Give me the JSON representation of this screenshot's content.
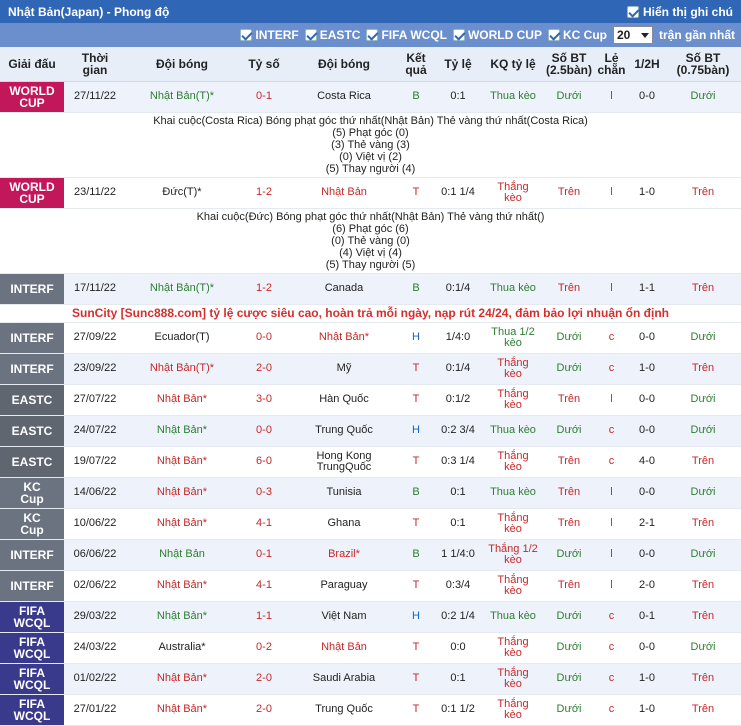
{
  "header": {
    "title": "Nhật Bản(Japan) - Phong độ",
    "show_note_label": "Hiển thị ghi chú"
  },
  "filters": {
    "items": [
      "INTERF",
      "EASTC",
      "FIFA WCQL",
      "WORLD CUP",
      "KC Cup"
    ],
    "count_value": "20",
    "count_suffix": "trận gần nhất"
  },
  "columns": [
    "Giải đấu",
    "Thời gian",
    "Đội bóng",
    "Tỷ số",
    "Đội bóng",
    "Kết quả",
    "Tỷ lệ",
    "KQ tỷ lệ",
    "Số BT (2.5bàn)",
    "Lẻ chẵn",
    "1/2H",
    "Số BT (0.75bàn)"
  ],
  "columns_split": [
    [
      "Giải đấu"
    ],
    [
      "Thời",
      "gian"
    ],
    [
      "Đội bóng"
    ],
    [
      "Tỷ số"
    ],
    [
      "Đội bóng"
    ],
    [
      "Kết",
      "quả"
    ],
    [
      "Tỷ lệ"
    ],
    [
      "KQ tỷ lệ"
    ],
    [
      "Số BT",
      "(2.5bàn)"
    ],
    [
      "Lẻ",
      "chẵn"
    ],
    [
      "1/2H"
    ],
    [
      "Số BT",
      "(0.75bàn)"
    ]
  ],
  "ad_text": "SunCity [Sunc888.com] tỷ lệ cược siêu cao, hoàn trả mỗi ngày, nạp rút 24/24, đảm bảo lợi nhuận ổn định",
  "rows": [
    {
      "league": "WORLD CUP",
      "lg": "WORLD",
      "date": "27/11/22",
      "home": "Nhật Bản(T)*",
      "home_style": "jp",
      "score": "0-1",
      "away": "Costa Rica",
      "away_style": "",
      "res": "B",
      "hc": "0:1",
      "kq": "Thua kèo",
      "kq_style": "lose",
      "ou": "Dưới",
      "le": "l",
      "half": "0-0",
      "ou2": "Dưới",
      "detail": [
        "Khai cuộc(Costa Rica)  Bóng phạt góc thứ nhất(Nhật Bản)  Thẻ vàng thứ nhất(Costa Rica)",
        "(5) Phạt góc (0)",
        "(3) Thẻ vàng (3)",
        "(0) Việt vị (2)",
        "(5) Thay người (4)"
      ]
    },
    {
      "league": "WORLD CUP",
      "lg": "WORLD",
      "date": "23/11/22",
      "home": "Đức(T)*",
      "home_style": "",
      "score": "1-2",
      "away": "Nhật Bản",
      "away_style": "hl",
      "res": "T",
      "hc": "0:1 1/4",
      "kq": "Thắng kèo",
      "kq_style": "win",
      "ou": "Trên",
      "le": "l",
      "half": "1-0",
      "ou2": "Trên",
      "detail": [
        "Khai cuộc(Đức)  Bóng phạt góc thứ nhất(Nhật Bản)  Thẻ vàng thứ nhất()",
        "(6) Phạt góc (6)",
        "(0) Thẻ vàng (0)",
        "(4) Việt vị (4)",
        "(5) Thay người (5)"
      ]
    },
    {
      "league": "INTERF",
      "lg": "INTERF",
      "date": "17/11/22",
      "home": "Nhật Bản(T)*",
      "home_style": "jp",
      "score": "1-2",
      "away": "Canada",
      "away_style": "",
      "res": "B",
      "hc": "0:1/4",
      "kq": "Thua kèo",
      "kq_style": "lose",
      "ou": "Trên",
      "le": "l",
      "half": "1-1",
      "ou2": "Trên"
    },
    {
      "ad": true
    },
    {
      "league": "INTERF",
      "lg": "INTERF",
      "date": "27/09/22",
      "home": "Ecuador(T)",
      "home_style": "",
      "score": "0-0",
      "away": "Nhật Bản*",
      "away_style": "hl",
      "res": "H",
      "hc": "1/4:0",
      "kq": "Thua 1/2 kèo",
      "kq_style": "lose",
      "ou": "Dưới",
      "le": "c",
      "half": "0-0",
      "ou2": "Dưới"
    },
    {
      "league": "INTERF",
      "lg": "INTERF",
      "date": "23/09/22",
      "home": "Nhật Bản(T)*",
      "home_style": "hl",
      "score": "2-0",
      "away": "Mỹ",
      "away_style": "",
      "res": "T",
      "hc": "0:1/4",
      "kq": "Thắng kèo",
      "kq_style": "win",
      "ou": "Dưới",
      "le": "c",
      "half": "1-0",
      "ou2": "Trên"
    },
    {
      "league": "EASTC",
      "lg": "EASTC",
      "date": "27/07/22",
      "home": "Nhật Bản*",
      "home_style": "hl",
      "score": "3-0",
      "away": "Hàn Quốc",
      "away_style": "",
      "res": "T",
      "hc": "0:1/2",
      "kq": "Thắng kèo",
      "kq_style": "win",
      "ou": "Trên",
      "le": "l",
      "half": "0-0",
      "ou2": "Dưới"
    },
    {
      "league": "EASTC",
      "lg": "EASTC",
      "date": "24/07/22",
      "home": "Nhật Bản*",
      "home_style": "jp",
      "score": "0-0",
      "away": "Trung Quốc",
      "away_style": "",
      "res": "H",
      "hc": "0:2 3/4",
      "kq": "Thua kèo",
      "kq_style": "lose",
      "ou": "Dưới",
      "le": "c",
      "half": "0-0",
      "ou2": "Dưới"
    },
    {
      "league": "EASTC",
      "lg": "EASTC",
      "date": "19/07/22",
      "home": "Nhật Bản*",
      "home_style": "hl",
      "score": "6-0",
      "away": "Hong Kong TrungQuốc",
      "away_style": "",
      "res": "T",
      "hc": "0:3 1/4",
      "kq": "Thắng kèo",
      "kq_style": "win",
      "ou": "Trên",
      "le": "c",
      "half": "4-0",
      "ou2": "Trên"
    },
    {
      "league": "KC Cup",
      "lg": "KC",
      "date": "14/06/22",
      "home": "Nhật Bản*",
      "home_style": "hl",
      "score": "0-3",
      "away": "Tunisia",
      "away_style": "",
      "res": "B",
      "hc": "0:1",
      "kq": "Thua kèo",
      "kq_style": "lose",
      "ou": "Trên",
      "le": "l",
      "half": "0-0",
      "ou2": "Dưới"
    },
    {
      "league": "KC Cup",
      "lg": "KC",
      "date": "10/06/22",
      "home": "Nhật Bản*",
      "home_style": "hl",
      "score": "4-1",
      "away": "Ghana",
      "away_style": "",
      "res": "T",
      "hc": "0:1",
      "kq": "Thắng kèo",
      "kq_style": "win",
      "ou": "Trên",
      "le": "l",
      "half": "2-1",
      "ou2": "Trên"
    },
    {
      "league": "INTERF",
      "lg": "INTERF",
      "date": "06/06/22",
      "home": "Nhật Bản",
      "home_style": "jp",
      "score": "0-1",
      "away": "Brazil*",
      "away_style": "hl",
      "res": "B",
      "hc": "1 1/4:0",
      "kq": "Thắng 1/2 kèo",
      "kq_style": "win",
      "ou": "Dưới",
      "le": "l",
      "half": "0-0",
      "ou2": "Dưới"
    },
    {
      "league": "INTERF",
      "lg": "INTERF",
      "date": "02/06/22",
      "home": "Nhật Bản*",
      "home_style": "hl",
      "score": "4-1",
      "away": "Paraguay",
      "away_style": "",
      "res": "T",
      "hc": "0:3/4",
      "kq": "Thắng kèo",
      "kq_style": "win",
      "ou": "Trên",
      "le": "l",
      "half": "2-0",
      "ou2": "Trên"
    },
    {
      "league": "FIFA WCQL",
      "lg": "FIFA",
      "date": "29/03/22",
      "home": "Nhật Bản*",
      "home_style": "jp",
      "score": "1-1",
      "away": "Việt Nam",
      "away_style": "",
      "res": "H",
      "hc": "0:2 1/4",
      "kq": "Thua kèo",
      "kq_style": "lose",
      "ou": "Dưới",
      "le": "c",
      "half": "0-1",
      "ou2": "Trên"
    },
    {
      "league": "FIFA WCQL",
      "lg": "FIFA",
      "date": "24/03/22",
      "home": "Australia*",
      "home_style": "",
      "score": "0-2",
      "away": "Nhật Bản",
      "away_style": "hl",
      "res": "T",
      "hc": "0:0",
      "kq": "Thắng kèo",
      "kq_style": "win",
      "ou": "Dưới",
      "le": "c",
      "half": "0-0",
      "ou2": "Dưới"
    },
    {
      "league": "FIFA WCQL",
      "lg": "FIFA",
      "date": "01/02/22",
      "home": "Nhật Bản*",
      "home_style": "hl",
      "score": "2-0",
      "away": "Saudi Arabia",
      "away_style": "",
      "res": "T",
      "hc": "0:1",
      "kq": "Thắng kèo",
      "kq_style": "win",
      "ou": "Dưới",
      "le": "c",
      "half": "1-0",
      "ou2": "Trên"
    },
    {
      "league": "FIFA WCQL",
      "lg": "FIFA",
      "date": "27/01/22",
      "home": "Nhật Bản*",
      "home_style": "hl",
      "score": "2-0",
      "away": "Trung Quốc",
      "away_style": "",
      "res": "T",
      "hc": "0:1 1/2",
      "kq": "Thắng kèo",
      "kq_style": "win",
      "ou": "Dưới",
      "le": "c",
      "half": "1-0",
      "ou2": "Trên"
    }
  ]
}
